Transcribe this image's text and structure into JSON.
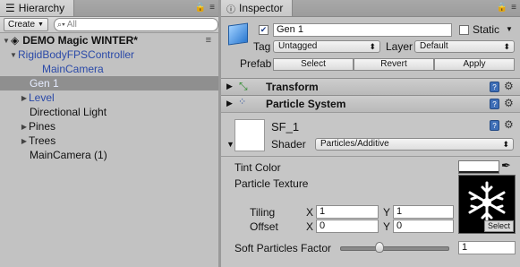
{
  "hierarchy": {
    "tab_title": "Hierarchy",
    "create_label": "Create",
    "search_placeholder": "All",
    "scene_name": "DEMO Magic WINTER*",
    "items": [
      {
        "label": "RigidBodyFPSController"
      },
      {
        "label": "MainCamera"
      },
      {
        "label": "Gen 1"
      },
      {
        "label": "Level"
      },
      {
        "label": "Directional Light"
      },
      {
        "label": "Pines"
      },
      {
        "label": "Trees"
      },
      {
        "label": "MainCamera (1)"
      }
    ]
  },
  "inspector": {
    "tab_title": "Inspector",
    "object_name": "Gen 1",
    "static_label": "Static",
    "tag_label": "Tag",
    "tag_value": "Untagged",
    "layer_label": "Layer",
    "layer_value": "Default",
    "prefab_label": "Prefab",
    "prefab_buttons": [
      "Select",
      "Revert",
      "Apply"
    ],
    "components": {
      "transform": "Transform",
      "particle_system": "Particle System"
    },
    "material": {
      "name": "SF_1",
      "shader_label": "Shader",
      "shader_value": "Particles/Additive",
      "tint_label": "Tint Color",
      "texture_label": "Particle Texture",
      "tiling_label": "Tiling",
      "offset_label": "Offset",
      "tiling_x": "1",
      "tiling_y": "1",
      "offset_x": "0",
      "offset_y": "0",
      "x_label": "X",
      "y_label": "Y",
      "select_label": "Select",
      "soft_label": "Soft Particles Factor",
      "soft_value": "1",
      "soft_slider_fraction": 0.14
    }
  },
  "colors": {
    "panel_bg": "#c2c2c2",
    "selection_bg": "#8f8f8f",
    "prefab_blue": "#2a49a8"
  }
}
